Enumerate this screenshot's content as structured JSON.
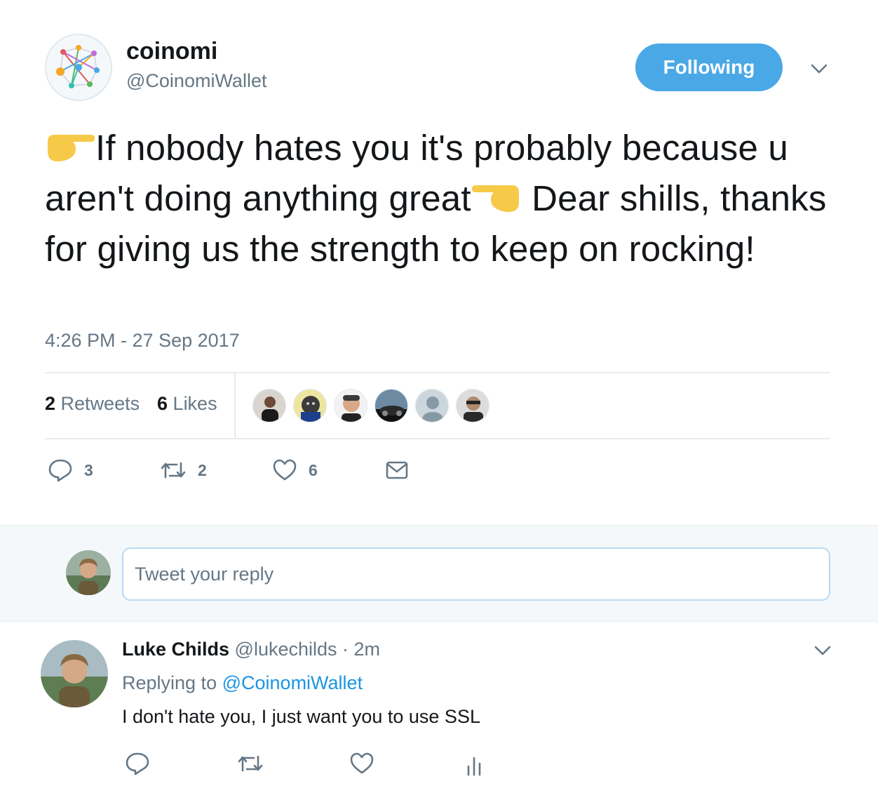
{
  "tweet": {
    "author": {
      "display_name": "coinomi",
      "handle": "@CoinomiWallet",
      "avatar_icon": "coinomi-logo"
    },
    "follow_button_label": "Following",
    "text_part1": "If nobody hates you it's probably because u aren't doing anything great",
    "text_part2": " Dear shills, thanks for giving us the strength to keep on rocking!",
    "emoji_left": "backhand-index-pointing-right",
    "emoji_right": "backhand-index-pointing-left",
    "timestamp": "4:26 PM - 27 Sep 2017",
    "stats": {
      "retweets_count": "2",
      "retweets_label": "Retweets",
      "likes_count": "6",
      "likes_label": "Likes"
    },
    "liker_avatar_count": 6,
    "actions": {
      "reply_count": "3",
      "retweet_count": "2",
      "like_count": "6"
    }
  },
  "reply_box": {
    "placeholder": "Tweet your reply"
  },
  "reply": {
    "display_name": "Luke Childs",
    "handle": "@lukechilds",
    "time": "· 2m",
    "replying_prefix": "Replying to",
    "replying_handle": "@CoinomiWallet",
    "text": "I don't hate you, I just want you to use SSL"
  },
  "colors": {
    "accent": "#4aa8e6",
    "link": "#1b95e0",
    "muted": "#657786",
    "emoji": "#f7c948"
  }
}
